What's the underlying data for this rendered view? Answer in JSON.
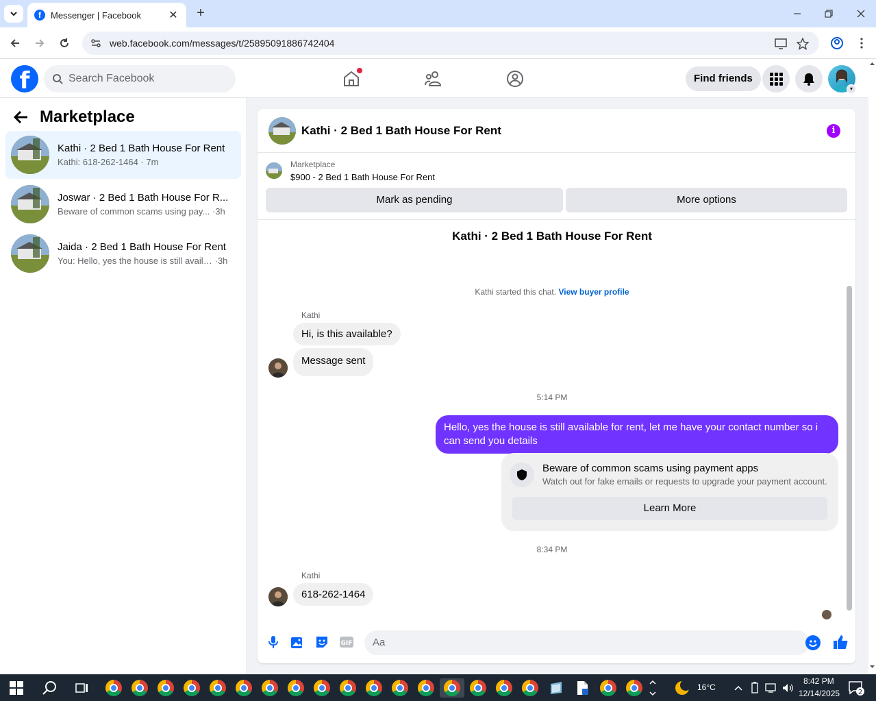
{
  "browser": {
    "tab_title": "Messenger | Facebook",
    "url": "web.facebook.com/messages/t/25895091886742404"
  },
  "fb": {
    "search_placeholder": "Search Facebook",
    "find_friends": "Find friends"
  },
  "sidebar": {
    "title": "Marketplace",
    "conversations": [
      {
        "title": "Kathi · 2 Bed 1 Bath House For Rent",
        "preview": "Kathi: 618-262-1464",
        "time": "7m",
        "active": true
      },
      {
        "title": "Joswar · 2 Bed 1 Bath House For R...",
        "preview": "Beware of common scams using pay...",
        "time": "3h",
        "active": false
      },
      {
        "title": "Jaida · 2 Bed 1 Bath House For Rent",
        "preview": "You: Hello, yes the house is still availa...",
        "time": "3h",
        "active": false
      }
    ]
  },
  "chat": {
    "header_title": "Kathi · 2 Bed 1 Bath House For Rent",
    "marketplace_label": "Marketplace",
    "listing": "$900 - 2 Bed 1 Bath House For Rent",
    "mark_pending": "Mark as pending",
    "more_options": "More options",
    "center_name": "Kathi · 2 Bed 1 Bath House For Rent",
    "started_text": "Kathi started this chat.",
    "view_profile": "View buyer profile",
    "sender1": "Kathi",
    "msg1": "Hi, is this available?",
    "msg2": "Message sent",
    "time1": "5:14 PM",
    "msg_out": "Hello, yes the house is still available for rent, let me have your contact number so i can send you  details",
    "scam_title": "Beware of common scams using payment apps",
    "scam_sub": "Watch out for fake emails or requests to upgrade your payment account.",
    "learn_more": "Learn More",
    "time2": "8:34 PM",
    "sender2": "Kathi",
    "msg3": "618-262-1464",
    "composer_placeholder": "Aa"
  },
  "taskbar": {
    "temperature": "16°C",
    "time": "8:42 PM",
    "date": "12/14/2025",
    "notifications": "2"
  },
  "colors": {
    "fb_blue": "#0866ff",
    "outgoing_bubble": "#7133ff",
    "info_purple": "#a200ff"
  }
}
